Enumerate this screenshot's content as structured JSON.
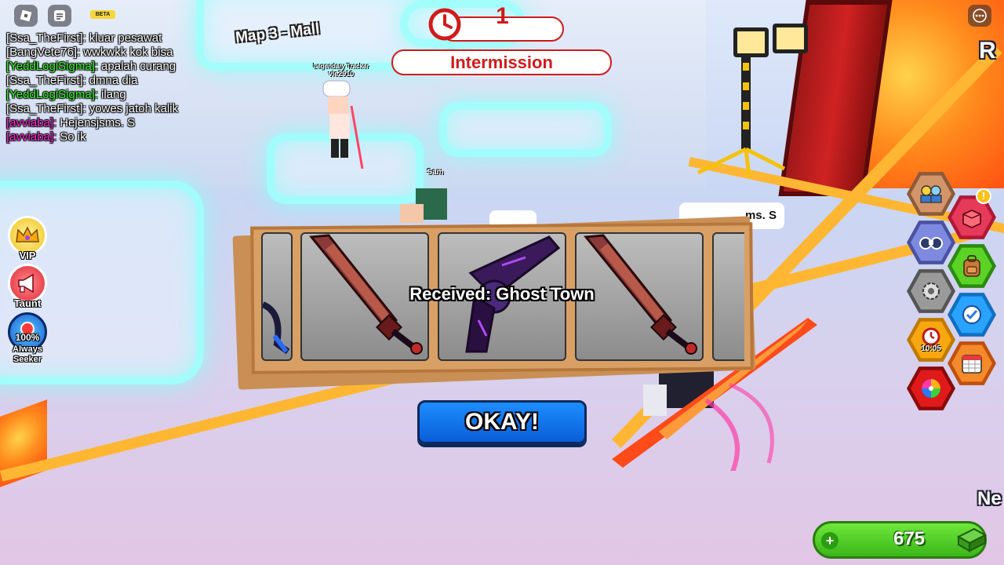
{
  "top_bar": {
    "beta_label": "BETA"
  },
  "chat": [
    {
      "name": "[Ssa_TheFirst]:",
      "name_color": "#ffffff",
      "message": "kluar pesawat"
    },
    {
      "name": "[BangVete76]:",
      "name_color": "#ffffff",
      "message": "wwkwkk kok bisa"
    },
    {
      "name": "[YeddLogiSigma]:",
      "name_color": "#39ff2a",
      "message": "apalah curang"
    },
    {
      "name": "[Ssa_TheFirst]:",
      "name_color": "#ffffff",
      "message": "dmna dia"
    },
    {
      "name": "[YeddLogiSigma]:",
      "name_color": "#39ff2a",
      "message": "ilang"
    },
    {
      "name": "[Ssa_TheFirst]:",
      "name_color": "#ffffff",
      "message": "yowes jatoh kalik"
    },
    {
      "name": "[avviaba]:",
      "name_color": "#ff2ad6",
      "message": "Hejensjsms. S"
    },
    {
      "name": "[avviaba]:",
      "name_color": "#ff2ad6",
      "message": "So ik"
    }
  ],
  "world": {
    "map_label": "Map 3 - Mall",
    "player_title": "Legendary Tracker",
    "player_name": "vie2910",
    "other_player": "Sam",
    "bubble_text": "ms. S",
    "edge_text_right_top": "R",
    "edge_text_right_bottom": "Ne"
  },
  "round": {
    "timer_value": "1",
    "status": "Intermission"
  },
  "left_buttons": [
    {
      "label": "VIP",
      "icon": "crown-icon"
    },
    {
      "label": "Taunt",
      "icon": "megaphone-icon"
    },
    {
      "label": "Always",
      "sub": "Seeker",
      "percent": "100%",
      "icon": "seeker-icon"
    }
  ],
  "right_buttons": {
    "daily_timer": "10:05"
  },
  "reward": {
    "received_text": "Received: Ghost Town",
    "items": [
      "knife",
      "revolver",
      "knife"
    ]
  },
  "okay_label": "OKAY!",
  "currency": {
    "amount": "675"
  },
  "colors": {
    "accent_red": "#d01a1a",
    "okay_blue": "#1d8dff",
    "currency_green": "#3bb51a"
  }
}
